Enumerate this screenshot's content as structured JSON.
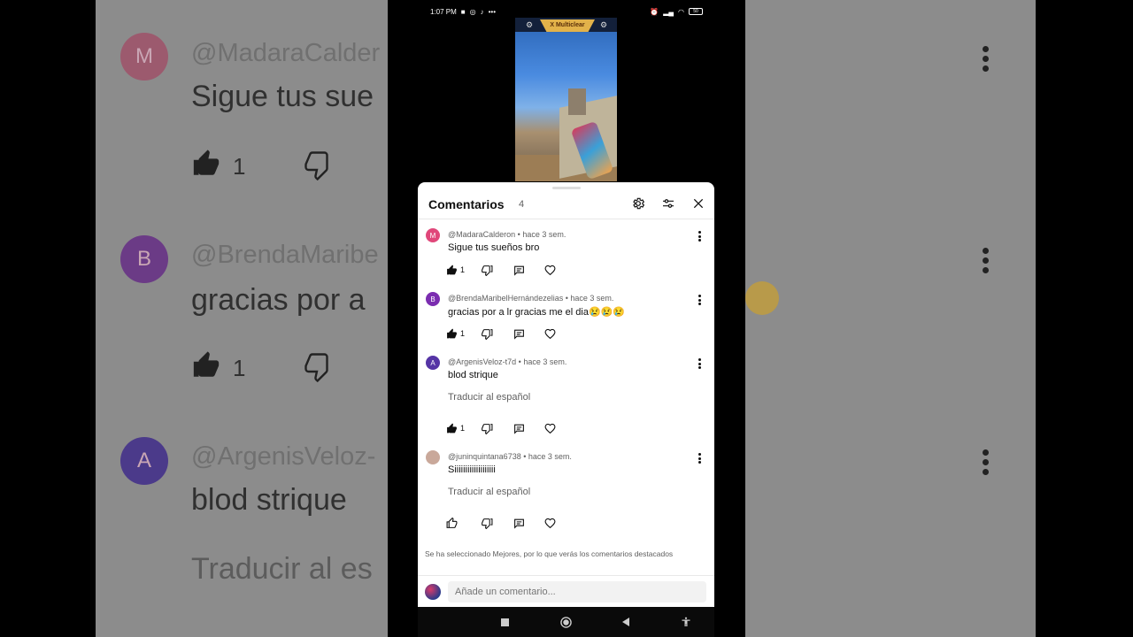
{
  "status_bar": {
    "time": "1:07 PM",
    "battery": "50"
  },
  "video": {
    "game_tag": "X Multiclear"
  },
  "comments_panel": {
    "title": "Comentarios",
    "count": "4",
    "comments": [
      {
        "author": "@MadaraCalderon",
        "age": "hace 3 sem.",
        "meta": "@MadaraCalderon • hace 3 sem.",
        "text": "Sigue tus sueños bro",
        "likes": "1",
        "avatar_letter": "M",
        "avatar_color": "#e0477a",
        "translate": ""
      },
      {
        "author": "@BrendaMaribelHernándezelias",
        "age": "hace 3 sem.",
        "meta": "@BrendaMaribelHernándezelias • hace 3 sem.",
        "text": "gracias por a lr gracias me el dia😢😢😢",
        "likes": "1",
        "avatar_letter": "B",
        "avatar_color": "#7b2db0",
        "translate": ""
      },
      {
        "author": "@ArgenisVeloz-t7d",
        "age": "hace 3 sem.",
        "meta": "@ArgenisVeloz-t7d • hace 3 sem.",
        "text": "blod strique",
        "likes": "1",
        "avatar_letter": "A",
        "avatar_color": "#5534a5",
        "translate": "Traducir al español"
      },
      {
        "author": "@juninquintana6738",
        "age": "hace 3 sem.",
        "meta": "@juninquintana6738 • hace 3 sem.",
        "text": "Siiiiiiiiiiiiiiiiiii",
        "likes": "",
        "avatar_letter": "",
        "avatar_color": "#c9a89a",
        "translate": "Traducir al español"
      }
    ],
    "sort_note": "Se ha seleccionado Mejores, por lo que verás los comentarios destacados",
    "input_placeholder": "Añade un comentario..."
  },
  "background_zoom": {
    "rows": [
      {
        "letter": "M",
        "handle": "@MadaraCalder",
        "text": "Sigue tus sue",
        "count": "1",
        "avatar_color": "#9c5a6e"
      },
      {
        "letter": "B",
        "handle": "@BrendaMaribe",
        "text": "gracias por a",
        "count": "1",
        "avatar_color": "#6b3b86"
      },
      {
        "letter": "A",
        "handle": "@ArgenisVeloz-",
        "text": "blod strique",
        "count": "",
        "avatar_color": "#4b3a8a"
      }
    ],
    "translate_partial": "Traducir al es"
  },
  "colors": {
    "sheet_bg": "#ffffff",
    "text_primary": "#0f0f0f",
    "text_secondary": "#606060"
  }
}
